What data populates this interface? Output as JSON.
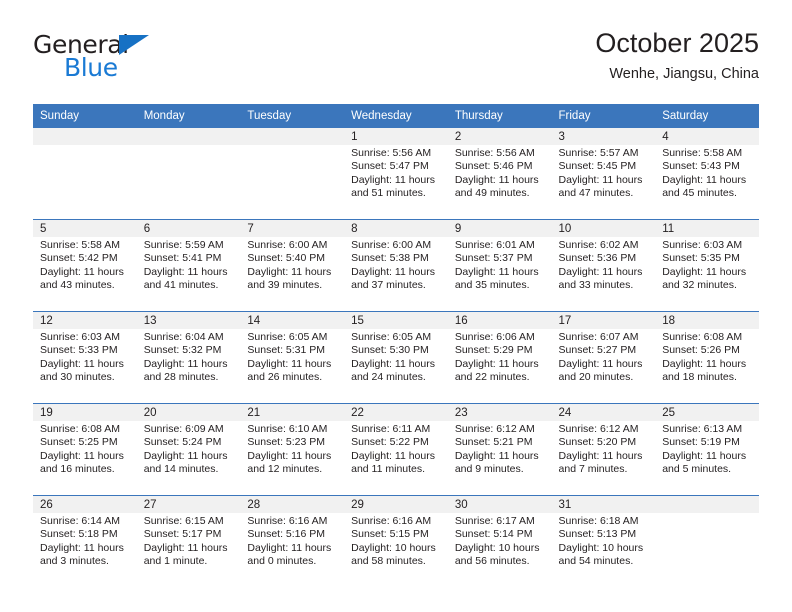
{
  "brand": {
    "name_part1": "General",
    "name_part2": "Blue",
    "icon": "triangle-logo-mark"
  },
  "header": {
    "title": "October 2025",
    "location": "Wenhe, Jiangsu, China"
  },
  "colors": {
    "header_blue": "#3b76bc",
    "brand_blue": "#1a7ad4",
    "day_band_gray": "#f1f1f1",
    "text": "#231f20"
  },
  "weekday_headers": [
    "Sunday",
    "Monday",
    "Tuesday",
    "Wednesday",
    "Thursday",
    "Friday",
    "Saturday"
  ],
  "weeks": [
    [
      {
        "day": "",
        "sunrise": "",
        "sunset": "",
        "daylight1": "",
        "daylight2": ""
      },
      {
        "day": "",
        "sunrise": "",
        "sunset": "",
        "daylight1": "",
        "daylight2": ""
      },
      {
        "day": "",
        "sunrise": "",
        "sunset": "",
        "daylight1": "",
        "daylight2": ""
      },
      {
        "day": "1",
        "sunrise": "Sunrise: 5:56 AM",
        "sunset": "Sunset: 5:47 PM",
        "daylight1": "Daylight: 11 hours",
        "daylight2": "and 51 minutes."
      },
      {
        "day": "2",
        "sunrise": "Sunrise: 5:56 AM",
        "sunset": "Sunset: 5:46 PM",
        "daylight1": "Daylight: 11 hours",
        "daylight2": "and 49 minutes."
      },
      {
        "day": "3",
        "sunrise": "Sunrise: 5:57 AM",
        "sunset": "Sunset: 5:45 PM",
        "daylight1": "Daylight: 11 hours",
        "daylight2": "and 47 minutes."
      },
      {
        "day": "4",
        "sunrise": "Sunrise: 5:58 AM",
        "sunset": "Sunset: 5:43 PM",
        "daylight1": "Daylight: 11 hours",
        "daylight2": "and 45 minutes."
      }
    ],
    [
      {
        "day": "5",
        "sunrise": "Sunrise: 5:58 AM",
        "sunset": "Sunset: 5:42 PM",
        "daylight1": "Daylight: 11 hours",
        "daylight2": "and 43 minutes."
      },
      {
        "day": "6",
        "sunrise": "Sunrise: 5:59 AM",
        "sunset": "Sunset: 5:41 PM",
        "daylight1": "Daylight: 11 hours",
        "daylight2": "and 41 minutes."
      },
      {
        "day": "7",
        "sunrise": "Sunrise: 6:00 AM",
        "sunset": "Sunset: 5:40 PM",
        "daylight1": "Daylight: 11 hours",
        "daylight2": "and 39 minutes."
      },
      {
        "day": "8",
        "sunrise": "Sunrise: 6:00 AM",
        "sunset": "Sunset: 5:38 PM",
        "daylight1": "Daylight: 11 hours",
        "daylight2": "and 37 minutes."
      },
      {
        "day": "9",
        "sunrise": "Sunrise: 6:01 AM",
        "sunset": "Sunset: 5:37 PM",
        "daylight1": "Daylight: 11 hours",
        "daylight2": "and 35 minutes."
      },
      {
        "day": "10",
        "sunrise": "Sunrise: 6:02 AM",
        "sunset": "Sunset: 5:36 PM",
        "daylight1": "Daylight: 11 hours",
        "daylight2": "and 33 minutes."
      },
      {
        "day": "11",
        "sunrise": "Sunrise: 6:03 AM",
        "sunset": "Sunset: 5:35 PM",
        "daylight1": "Daylight: 11 hours",
        "daylight2": "and 32 minutes."
      }
    ],
    [
      {
        "day": "12",
        "sunrise": "Sunrise: 6:03 AM",
        "sunset": "Sunset: 5:33 PM",
        "daylight1": "Daylight: 11 hours",
        "daylight2": "and 30 minutes."
      },
      {
        "day": "13",
        "sunrise": "Sunrise: 6:04 AM",
        "sunset": "Sunset: 5:32 PM",
        "daylight1": "Daylight: 11 hours",
        "daylight2": "and 28 minutes."
      },
      {
        "day": "14",
        "sunrise": "Sunrise: 6:05 AM",
        "sunset": "Sunset: 5:31 PM",
        "daylight1": "Daylight: 11 hours",
        "daylight2": "and 26 minutes."
      },
      {
        "day": "15",
        "sunrise": "Sunrise: 6:05 AM",
        "sunset": "Sunset: 5:30 PM",
        "daylight1": "Daylight: 11 hours",
        "daylight2": "and 24 minutes."
      },
      {
        "day": "16",
        "sunrise": "Sunrise: 6:06 AM",
        "sunset": "Sunset: 5:29 PM",
        "daylight1": "Daylight: 11 hours",
        "daylight2": "and 22 minutes."
      },
      {
        "day": "17",
        "sunrise": "Sunrise: 6:07 AM",
        "sunset": "Sunset: 5:27 PM",
        "daylight1": "Daylight: 11 hours",
        "daylight2": "and 20 minutes."
      },
      {
        "day": "18",
        "sunrise": "Sunrise: 6:08 AM",
        "sunset": "Sunset: 5:26 PM",
        "daylight1": "Daylight: 11 hours",
        "daylight2": "and 18 minutes."
      }
    ],
    [
      {
        "day": "19",
        "sunrise": "Sunrise: 6:08 AM",
        "sunset": "Sunset: 5:25 PM",
        "daylight1": "Daylight: 11 hours",
        "daylight2": "and 16 minutes."
      },
      {
        "day": "20",
        "sunrise": "Sunrise: 6:09 AM",
        "sunset": "Sunset: 5:24 PM",
        "daylight1": "Daylight: 11 hours",
        "daylight2": "and 14 minutes."
      },
      {
        "day": "21",
        "sunrise": "Sunrise: 6:10 AM",
        "sunset": "Sunset: 5:23 PM",
        "daylight1": "Daylight: 11 hours",
        "daylight2": "and 12 minutes."
      },
      {
        "day": "22",
        "sunrise": "Sunrise: 6:11 AM",
        "sunset": "Sunset: 5:22 PM",
        "daylight1": "Daylight: 11 hours",
        "daylight2": "and 11 minutes."
      },
      {
        "day": "23",
        "sunrise": "Sunrise: 6:12 AM",
        "sunset": "Sunset: 5:21 PM",
        "daylight1": "Daylight: 11 hours",
        "daylight2": "and 9 minutes."
      },
      {
        "day": "24",
        "sunrise": "Sunrise: 6:12 AM",
        "sunset": "Sunset: 5:20 PM",
        "daylight1": "Daylight: 11 hours",
        "daylight2": "and 7 minutes."
      },
      {
        "day": "25",
        "sunrise": "Sunrise: 6:13 AM",
        "sunset": "Sunset: 5:19 PM",
        "daylight1": "Daylight: 11 hours",
        "daylight2": "and 5 minutes."
      }
    ],
    [
      {
        "day": "26",
        "sunrise": "Sunrise: 6:14 AM",
        "sunset": "Sunset: 5:18 PM",
        "daylight1": "Daylight: 11 hours",
        "daylight2": "and 3 minutes."
      },
      {
        "day": "27",
        "sunrise": "Sunrise: 6:15 AM",
        "sunset": "Sunset: 5:17 PM",
        "daylight1": "Daylight: 11 hours",
        "daylight2": "and 1 minute."
      },
      {
        "day": "28",
        "sunrise": "Sunrise: 6:16 AM",
        "sunset": "Sunset: 5:16 PM",
        "daylight1": "Daylight: 11 hours",
        "daylight2": "and 0 minutes."
      },
      {
        "day": "29",
        "sunrise": "Sunrise: 6:16 AM",
        "sunset": "Sunset: 5:15 PM",
        "daylight1": "Daylight: 10 hours",
        "daylight2": "and 58 minutes."
      },
      {
        "day": "30",
        "sunrise": "Sunrise: 6:17 AM",
        "sunset": "Sunset: 5:14 PM",
        "daylight1": "Daylight: 10 hours",
        "daylight2": "and 56 minutes."
      },
      {
        "day": "31",
        "sunrise": "Sunrise: 6:18 AM",
        "sunset": "Sunset: 5:13 PM",
        "daylight1": "Daylight: 10 hours",
        "daylight2": "and 54 minutes."
      },
      {
        "day": "",
        "sunrise": "",
        "sunset": "",
        "daylight1": "",
        "daylight2": ""
      }
    ]
  ]
}
